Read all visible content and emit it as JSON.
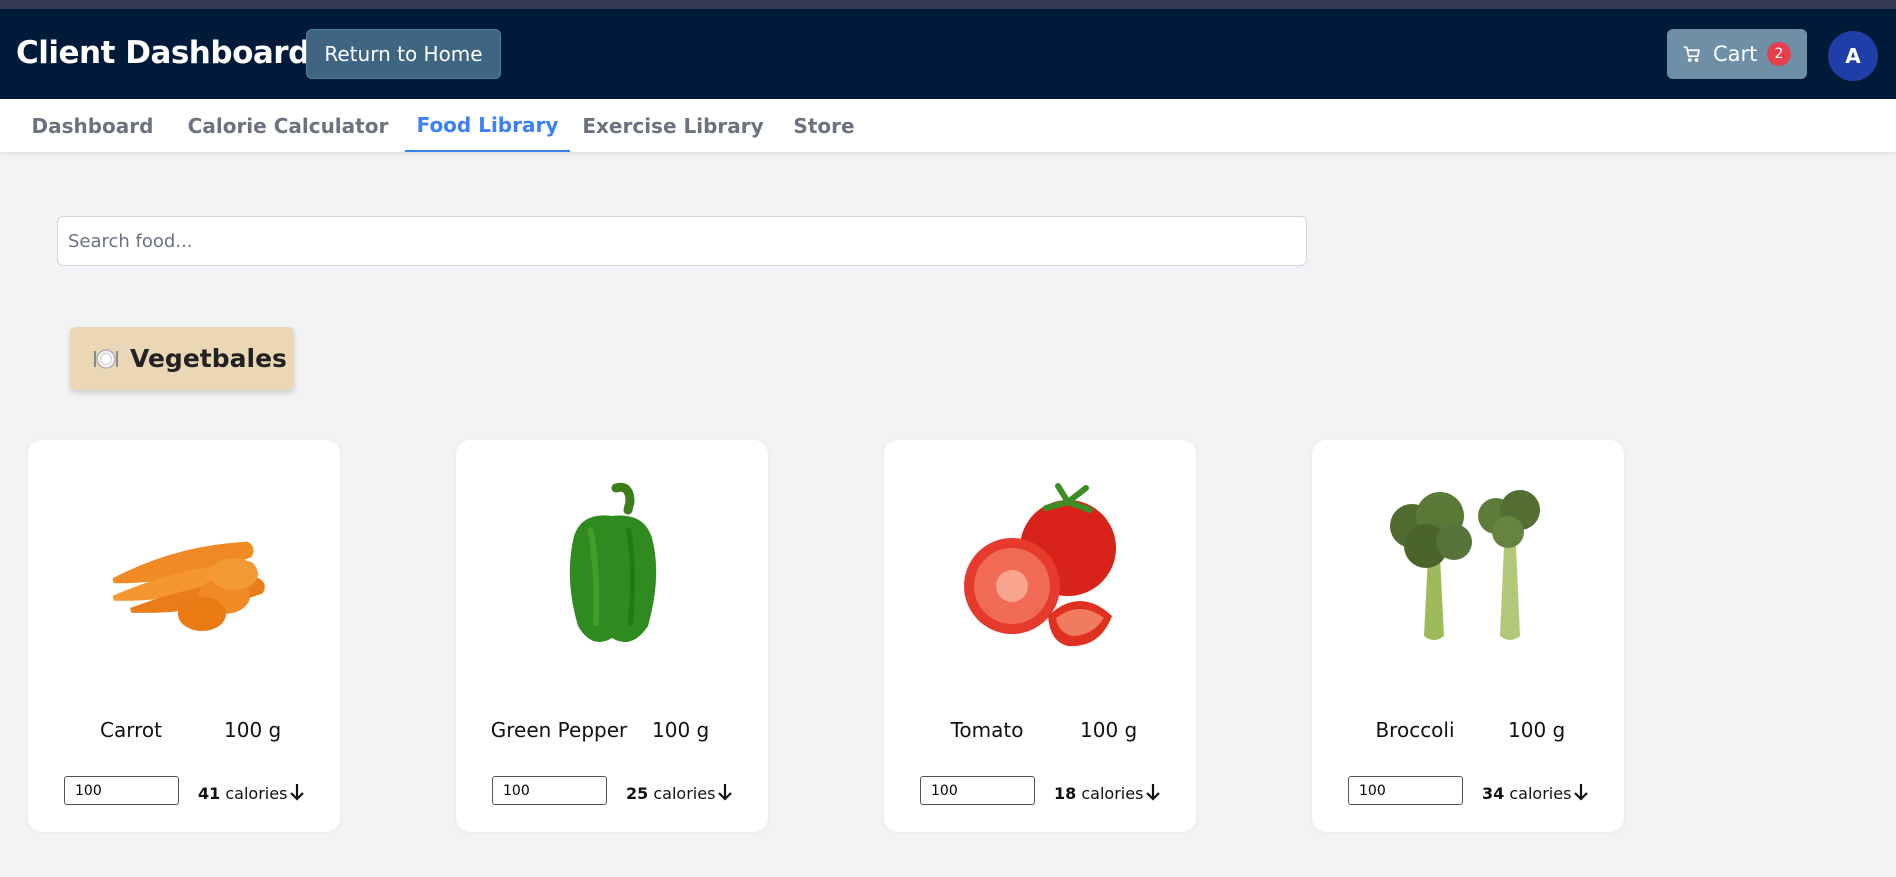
{
  "header": {
    "title": "Client Dashboard",
    "home_button": "Return to Home",
    "cart_label": "Cart",
    "cart_count": "2",
    "avatar_initial": "A"
  },
  "nav": {
    "tabs": [
      {
        "label": "Dashboard",
        "active": false
      },
      {
        "label": "Calorie Calculator",
        "active": false
      },
      {
        "label": "Food Library",
        "active": true
      },
      {
        "label": "Exercise Library",
        "active": false
      },
      {
        "label": "Store",
        "active": false
      }
    ]
  },
  "search": {
    "placeholder": "Search food..."
  },
  "category": {
    "icon": "plate-icon",
    "label": "Vegetbales"
  },
  "foods": [
    {
      "name": "Carrot",
      "weight": "100 g",
      "qty": "100",
      "calories": "41",
      "unit": "calories",
      "icon": "carrot-image"
    },
    {
      "name": "Green Pepper",
      "weight": "100 g",
      "qty": "100",
      "calories": "25",
      "unit": "calories",
      "icon": "pepper-image"
    },
    {
      "name": "Tomato",
      "weight": "100 g",
      "qty": "100",
      "calories": "18",
      "unit": "calories",
      "icon": "tomato-image"
    },
    {
      "name": "Broccoli",
      "weight": "100 g",
      "qty": "100",
      "calories": "34",
      "unit": "calories",
      "icon": "broccoli-image"
    }
  ],
  "colors": {
    "header_bg": "#001b3a",
    "accent": "#3b82f6",
    "category_bg": "#ead7b5",
    "badge": "#e53e4d"
  }
}
